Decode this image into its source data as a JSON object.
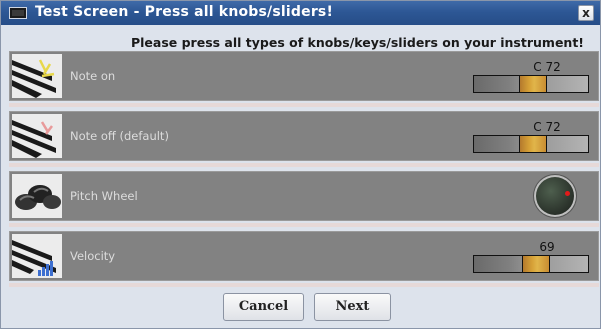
{
  "window": {
    "title": "Test Screen - Press all knobs/sliders!",
    "close_label": "x"
  },
  "header": {
    "instruction": "Please press all types of knobs/keys/sliders on your instrument!"
  },
  "rows": [
    {
      "label": "Note on",
      "value": "C 72",
      "icon": "piano-keys-note-on-icon",
      "control": "meter",
      "level": 0.52
    },
    {
      "label": "Note off (default)",
      "value": "C 72",
      "icon": "piano-keys-note-off-icon",
      "control": "meter",
      "level": 0.52
    },
    {
      "label": "Pitch Wheel",
      "value": "",
      "icon": "pitch-wheel-icon",
      "control": "knob",
      "level": 0.8
    },
    {
      "label": "Velocity",
      "value": "69",
      "icon": "piano-keys-velocity-icon",
      "control": "meter",
      "level": 0.54
    }
  ],
  "footer": {
    "cancel_label": "Cancel",
    "next_label": "Next"
  },
  "colors": {
    "title_bar": "#2d5795",
    "row_bg": "#828282",
    "meter_fill": "#d6a137",
    "knob_dot": "#e31a1a"
  }
}
